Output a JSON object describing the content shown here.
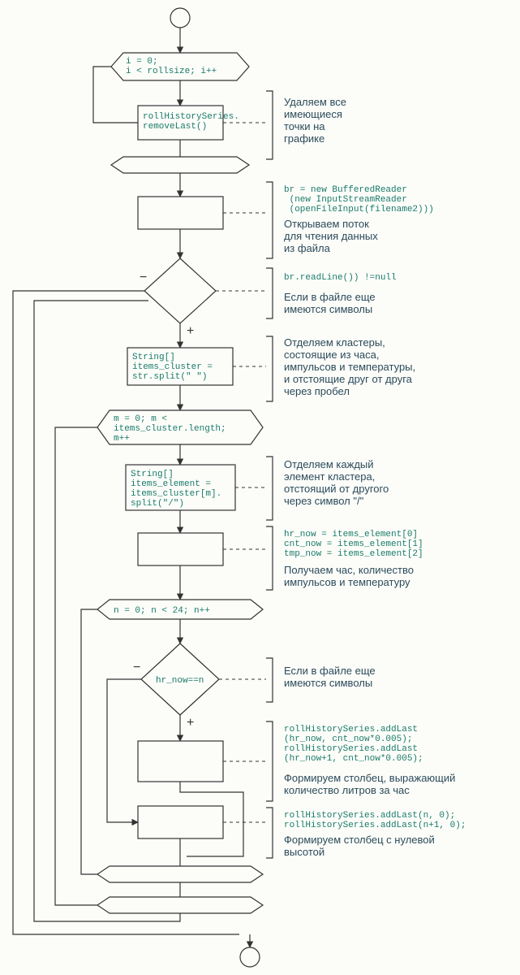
{
  "nodes": {
    "loop1_header": "i = 0;\ni < rollsize; i++",
    "block1": "rollHistorySeries.\nremoveLast()",
    "ann1_desc": "Удаляем все\nимеющиеся\nточки на\nграфике",
    "block2_code": "br = new BufferedReader\n (new InputStreamReader\n (openFileInput(filename2)))",
    "block2_desc": "Открываем поток\nдля чтения данных\nиз файла",
    "dec1_code": "br.readLine()) !=null",
    "dec1_desc": "Если в файле еще\nимеются символы",
    "dec1_minus": "−",
    "dec1_plus": "+",
    "block3_code": "String[]\nitems_cluster =\nstr.split(\" \")",
    "block3_desc": "Отделяем кластеры,\nсостоящие из часа,\nимпульсов и температуры,\nи отстоящие друг от друга\nчерез пробел",
    "loop2_header": "m = 0; m <\nitems_cluster.length;\nm++",
    "block4_code": "String[]\nitems_element =\nitems_cluster[m].\nsplit(\"/\")",
    "block4_desc": "Отделяем каждый\nэлемент кластера,\nотстоящий от другого\nчерез символ \"/\"",
    "block5_code": "hr_now = items_element[0]\ncnt_now = items_element[1]\ntmp_now = items_element[2]",
    "block5_desc": "Получаем час, количество\nимпульсов и температуру",
    "loop3_header": "n = 0; n < 24; n++",
    "dec2_code": "hr_now==n",
    "dec2_desc": "Если в файле еще\nимеются символы",
    "dec2_minus": "−",
    "dec2_plus": "+",
    "block6_code": "rollHistorySeries.addLast\n(hr_now, cnt_now*0.005);\nrollHistorySeries.addLast\n(hr_now+1, cnt_now*0.005);",
    "block6_desc": "Формируем столбец, выражающий\nколичество литров за час",
    "block7_code": "rollHistorySeries.addLast(n, 0);\nrollHistorySeries.addLast(n+1, 0);",
    "block7_desc": "Формируем столбец с нулевой\nвысотой"
  }
}
